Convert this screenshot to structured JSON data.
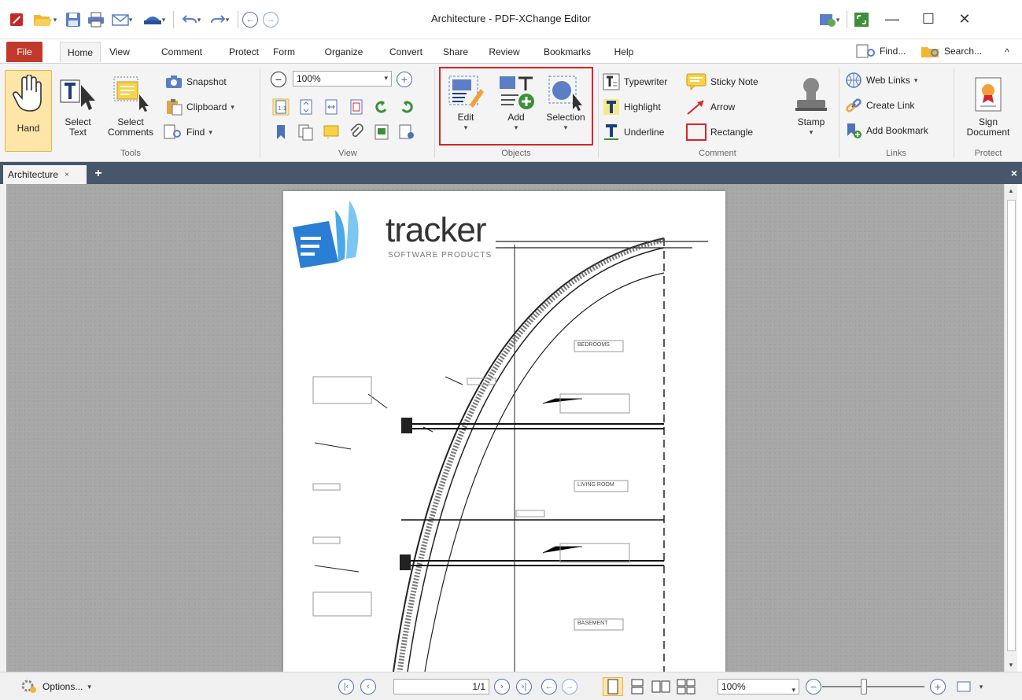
{
  "window": {
    "title": "Architecture - PDF-XChange Editor",
    "minimize": "—",
    "maximize": "☐",
    "close": "✕"
  },
  "tabs": [
    "File",
    "Home",
    "View",
    "Comment",
    "Protect",
    "Form",
    "Organize",
    "Convert",
    "Share",
    "Review",
    "Bookmarks",
    "Help"
  ],
  "active_tab": "Home",
  "ribbon_right": {
    "find": "Find...",
    "search": "Search...",
    "collapse": "^"
  },
  "tools": {
    "hand": "Hand",
    "select_text_1": "Select",
    "select_text_2": "Text",
    "select_comments_1": "Select",
    "select_comments_2": "Comments",
    "snapshot": "Snapshot",
    "clipboard": "Clipboard",
    "find": "Find",
    "label": "Tools"
  },
  "view": {
    "zoom": "100%",
    "label": "View"
  },
  "objects": {
    "edit": "Edit",
    "add": "Add",
    "selection": "Selection",
    "label": "Objects"
  },
  "comment": {
    "typewriter": "Typewriter",
    "sticky_note": "Sticky Note",
    "highlight": "Highlight",
    "arrow": "Arrow",
    "underline": "Underline",
    "rectangle": "Rectangle",
    "stamp": "Stamp",
    "label": "Comment"
  },
  "links": {
    "web_links": "Web Links",
    "create_link": "Create Link",
    "add_bookmark": "Add Bookmark",
    "label": "Links"
  },
  "protect": {
    "sign_1": "Sign",
    "sign_2": "Document",
    "label": "Protect"
  },
  "doc_tab": {
    "name": "Architecture",
    "close": "×",
    "new": "+",
    "close_all": "×"
  },
  "page_content": {
    "logo_word": "tracker",
    "logo_sub": "SOFTWARE PRODUCTS",
    "rooms": [
      "BEDROOMS",
      "LIVING ROOM",
      "BASEMENT"
    ]
  },
  "statusbar": {
    "options": "Options...",
    "page": "1/1",
    "zoom": "100%"
  },
  "colors": {
    "file_tab": "#c0392b",
    "doc_bar": "#47566a",
    "objects_highlight": "#d9232a",
    "hand_active": "#fde6a8",
    "accent_blue": "#4c72b8"
  }
}
